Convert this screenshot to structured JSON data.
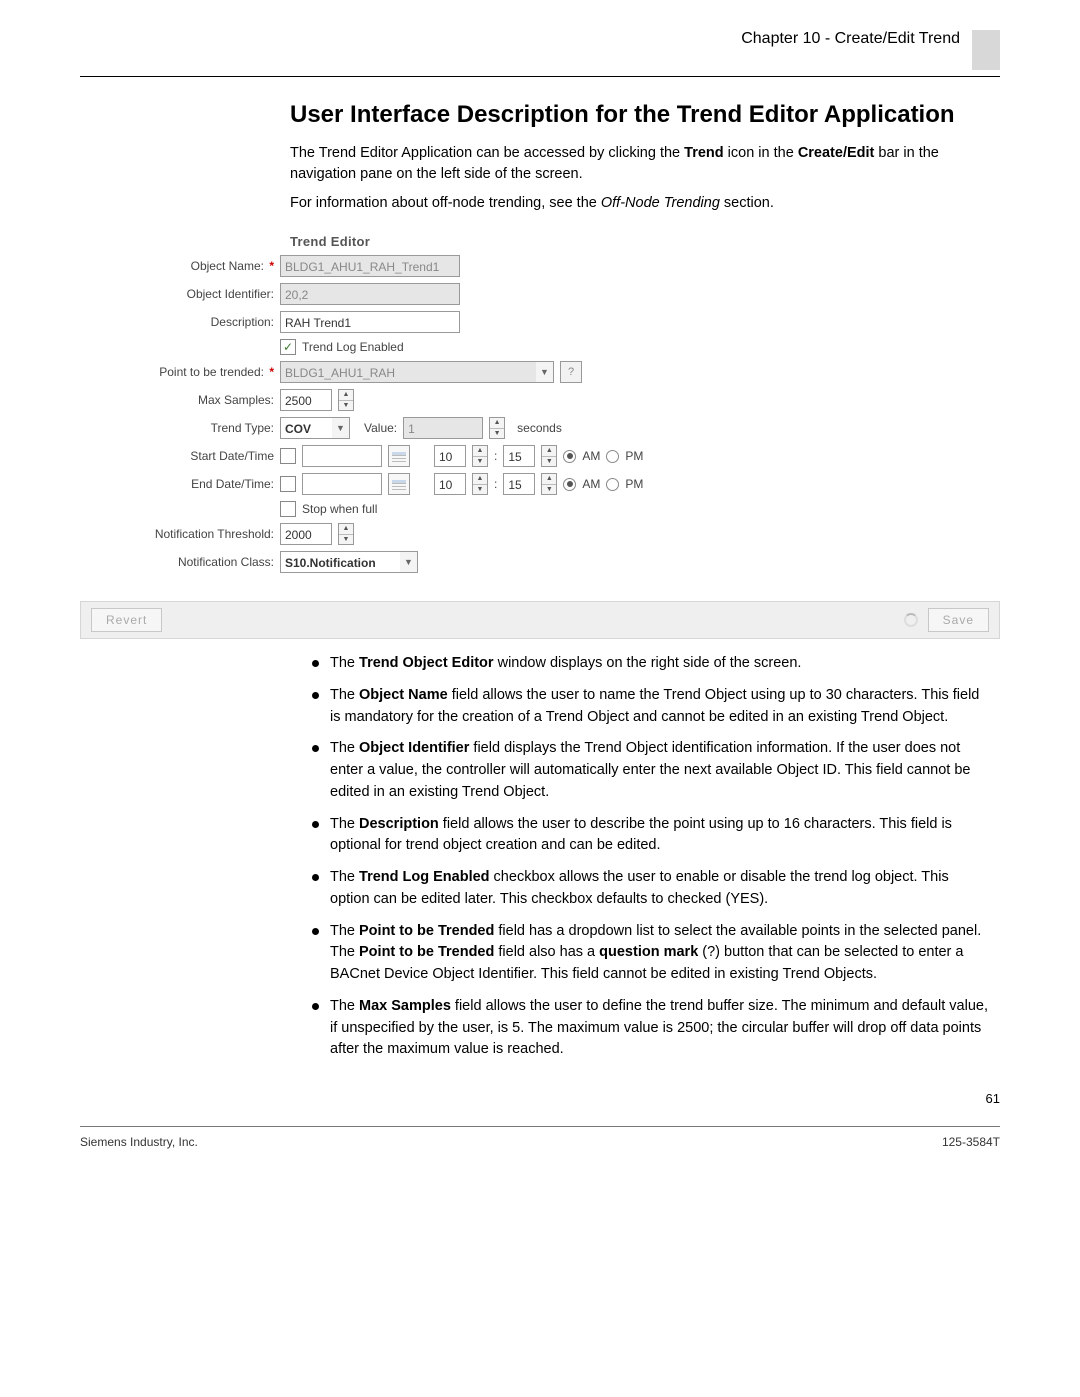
{
  "header": {
    "chapter": "Chapter 10 - Create/Edit",
    "subtitle": "Trend"
  },
  "section": {
    "title": "User Interface Description for the Trend Editor Application",
    "intro1_a": "The Trend Editor Application can be accessed by clicking the ",
    "intro1_b": "Trend",
    "intro1_c": " icon in the ",
    "intro1_d": "Create/Edit",
    "intro1_e": " bar in the navigation pane on the left side of the screen.",
    "intro2_a": "For information about off-node trending, see the ",
    "intro2_b": "Off-Node Trending",
    "intro2_c": " section."
  },
  "editor": {
    "title": "Trend Editor",
    "object_name_label": "Object Name:",
    "object_name_value": "BLDG1_AHU1_RAH_Trend1",
    "object_id_label": "Object Identifier:",
    "object_id_value": "20,2",
    "description_label": "Description:",
    "description_value": "RAH Trend1",
    "trend_log_enabled_label": "Trend Log Enabled",
    "point_label": "Point to be trended:",
    "point_value": "BLDG1_AHU1_RAH",
    "help_label": "?",
    "max_samples_label": "Max Samples:",
    "max_samples_value": "2500",
    "trend_type_label": "Trend Type:",
    "trend_type_value": "COV",
    "value_label": "Value:",
    "value_num": "1",
    "seconds_label": "seconds",
    "start_label": "Start Date/Time",
    "end_label": "End Date/Time:",
    "hour": "10",
    "minute": "15",
    "am": "AM",
    "pm": "PM",
    "stop_label": "Stop when full",
    "notif_thresh_label": "Notification Threshold:",
    "notif_thresh_value": "2000",
    "notif_class_label": "Notification Class:",
    "notif_class_value": "S10.Notification",
    "revert": "Revert",
    "save": "Save"
  },
  "bullets": {
    "b1_a": "The ",
    "b1_b": "Trend Object Editor",
    "b1_c": " window displays on the right side of the screen.",
    "b2_a": "The ",
    "b2_b": "Object Name",
    "b2_c": " field allows the user to name the Trend Object using up to 30 characters. This field is mandatory for the creation of a Trend Object and cannot be edited in an existing Trend Object.",
    "b3_a": "The ",
    "b3_b": "Object Identifier",
    "b3_c": " field displays the Trend Object identification information. If the user does not enter a value, the controller will automatically enter the next available Object ID. This field cannot be edited in an existing Trend Object.",
    "b4_a": "The ",
    "b4_b": "Description",
    "b4_c": " field allows the user to describe the point using up to 16 characters. This field is optional for trend object creation and can be edited.",
    "b5_a": "The ",
    "b5_b": "Trend Log Enabled",
    "b5_c": " checkbox allows the user to enable or disable the trend log object. This option can be edited later. This checkbox defaults to checked (YES).",
    "b6_a": "The ",
    "b6_b": "Point to be Trended",
    "b6_c": " field has a dropdown list to select the available points in the selected panel. The ",
    "b6_d": "Point to be Trended",
    "b6_e": " field also has a ",
    "b6_f": "question mark",
    "b6_g": " (?) button that can be selected to enter a BACnet Device Object Identifier. This field cannot be edited in existing Trend Objects.",
    "b7_a": "The ",
    "b7_b": "Max Samples",
    "b7_c": " field allows the user to define the trend buffer size. The minimum and default value, if unspecified by the user, is 5. The maximum value is 2500; the circular buffer will drop off data points after the maximum value is reached."
  },
  "footer": {
    "page": "61",
    "company": "Siemens Industry, Inc.",
    "docnum": "125-3584T"
  }
}
